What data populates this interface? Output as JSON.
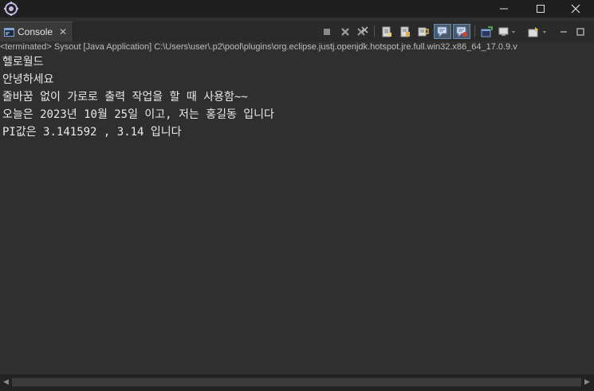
{
  "window": {
    "minimize_glyph": "—",
    "maximize_glyph": "□",
    "close_glyph": "✕"
  },
  "view": {
    "tab_label": "Console",
    "tab_close": "✕"
  },
  "toolbar": {
    "icons": [
      "terminate-icon",
      "remove-launch-icon",
      "remove-all-terminated-icon",
      "clear-console-icon",
      "scroll-lock-icon",
      "word-wrap-icon",
      "show-on-stdout-icon",
      "show-on-stderr-icon",
      "pin-console-icon",
      "display-console-icon",
      "open-console-icon",
      "minimize-view-icon",
      "maximize-view-icon"
    ]
  },
  "process": {
    "description": "<terminated> Sysout [Java Application] C:\\Users\\user\\.p2\\pool\\plugins\\org.eclipse.justj.openjdk.hotspot.jre.full.win32.x86_64_17.0.9.v"
  },
  "console": {
    "lines": [
      "헬로월드",
      "안녕하세요",
      "줄바꿈 없이 가로로 출력 작업을 할 때 사용함~~",
      "오늘은 2023년 10월 25일 이고, 저는 홍길동 입니다",
      "PI값은 3.141592 , 3.14 입니다"
    ]
  },
  "colors": {
    "background": "#2f2f2f",
    "titlebar": "#1f1f1f",
    "text": "#e8e8e8",
    "active_toggle": "#4a5a6a"
  }
}
